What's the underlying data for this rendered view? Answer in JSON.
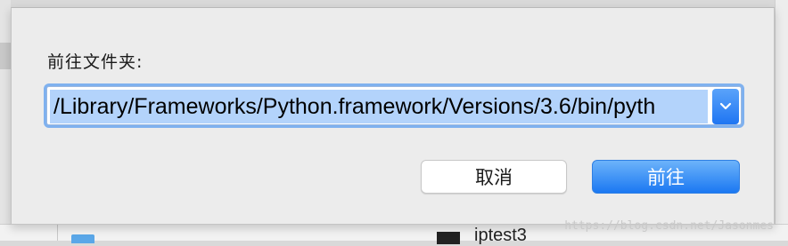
{
  "dialog": {
    "label": "前往文件夹:",
    "path_value": "/Library/Frameworks/Python.framework/Versions/3.6/bin/pyth",
    "dropdown_icon": "chevron-down-icon",
    "cancel_label": "取消",
    "go_label": "前往"
  },
  "background": {
    "file_name": "iptest3"
  },
  "watermark": "https://blog.csdn.net/Jasonmes",
  "colors": {
    "accent": "#1b78f2",
    "selection": "#b3d3fb",
    "focus_ring": "#7fb1ef"
  }
}
